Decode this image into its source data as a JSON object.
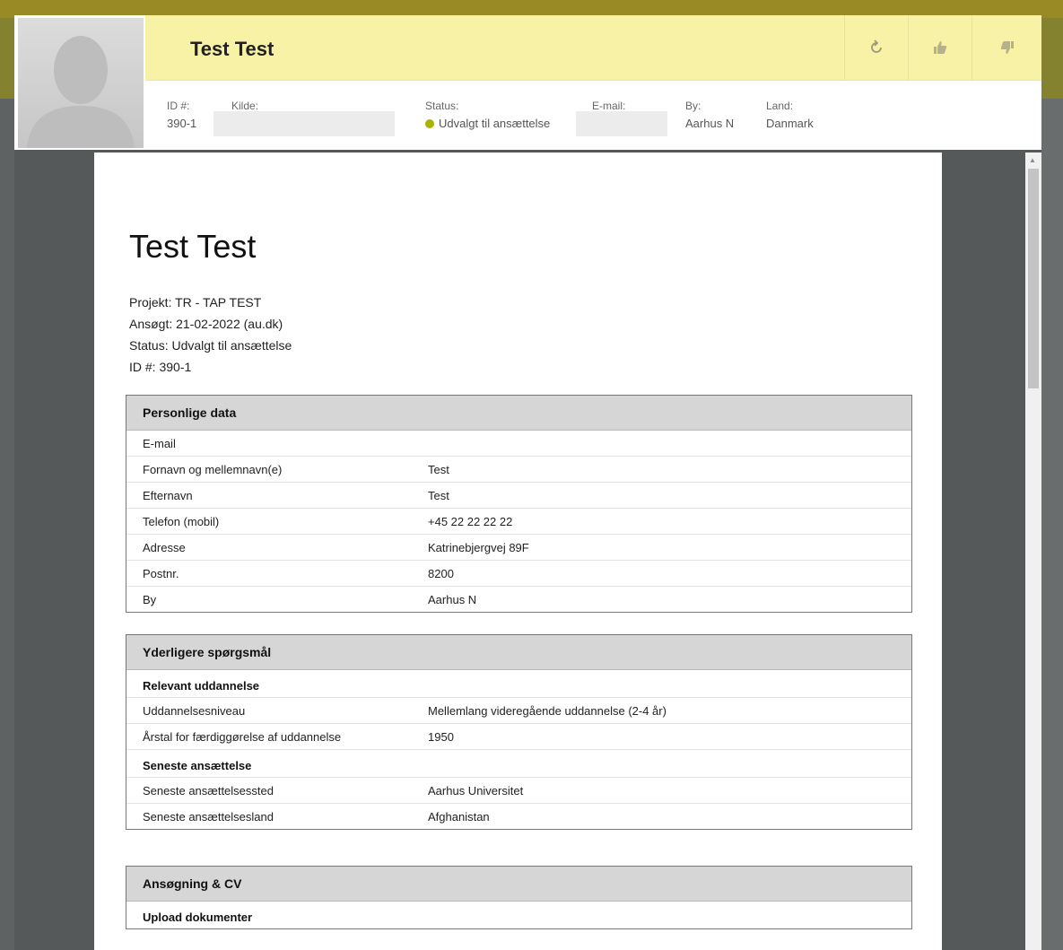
{
  "header": {
    "name": "Test Test",
    "fields": {
      "id_label": "ID #:",
      "id_value": "390-1",
      "source_label": "Kilde:",
      "status_label": "Status:",
      "status_value": "Udvalgt til ansættelse",
      "email_label": "E-mail:",
      "city_label": "By:",
      "city_value": "Aarhus N",
      "country_label": "Land:",
      "country_value": "Danmark"
    },
    "icons": [
      "refresh-icon",
      "thumbs-up-icon",
      "thumbs-down-icon"
    ]
  },
  "document": {
    "title": "Test Test",
    "meta": {
      "project": "Projekt: TR - TAP TEST",
      "applied": "Ansøgt: 21-02-2022 (au.dk)",
      "status": "Status: Udvalgt til ansættelse",
      "id": "ID #: 390-1"
    },
    "personal": {
      "title": "Personlige data",
      "rows": [
        {
          "k": "E-mail",
          "v": ""
        },
        {
          "k": "Fornavn og mellemnavn(e)",
          "v": "Test"
        },
        {
          "k": "Efternavn",
          "v": "Test"
        },
        {
          "k": "Telefon (mobil)",
          "v": "+45 22 22 22 22"
        },
        {
          "k": "Adresse",
          "v": "Katrinebjergvej 89F"
        },
        {
          "k": "Postnr.",
          "v": "8200"
        },
        {
          "k": "By",
          "v": "Aarhus N"
        }
      ]
    },
    "questions": {
      "title": "Yderligere spørgsmål",
      "sub1": "Relevant uddannelse",
      "rows1": [
        {
          "k": "Uddannelsesniveau",
          "v": "Mellemlang videregående uddannelse (2-4 år)"
        },
        {
          "k": "Årstal for færdiggørelse af uddannelse",
          "v": "1950"
        }
      ],
      "sub2": "Seneste ansættelse",
      "rows2": [
        {
          "k": "Seneste ansættelsessted",
          "v": "Aarhus Universitet"
        },
        {
          "k": "Seneste ansættelsesland",
          "v": "Afghanistan"
        }
      ]
    },
    "application": {
      "title": "Ansøgning & CV",
      "sub": "Upload dokumenter"
    }
  },
  "colors": {
    "header_yellow": "#f7f2a5",
    "status_dot": "#a8b400",
    "backdrop": "#5f6263"
  }
}
